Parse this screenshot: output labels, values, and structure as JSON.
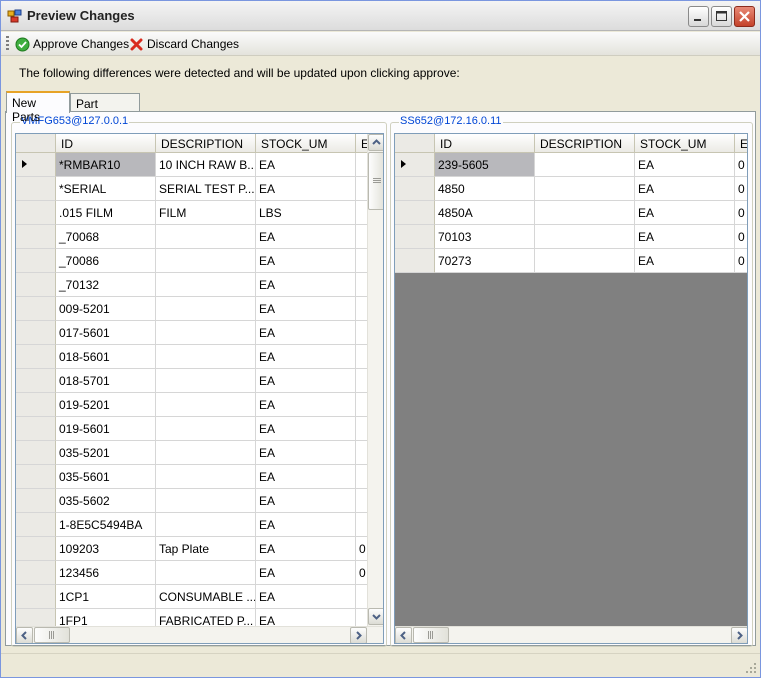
{
  "window": {
    "title": "Preview Changes"
  },
  "toolbar": {
    "approve_label": "Approve Changes",
    "approve_icon": "check-circle-icon",
    "discard_label": "Discard Changes",
    "discard_icon": "red-x-icon"
  },
  "message": "The following differences were detected and will be updated upon clicking approve:",
  "tabs": [
    {
      "label": "New Parts",
      "selected": true
    },
    {
      "label": "Part Updates",
      "selected": false
    }
  ],
  "left_panel": {
    "title": "VMFG653@127.0.0.1",
    "columns": [
      "ID",
      "DESCRIPTION",
      "STOCK_UM",
      "E"
    ],
    "rows": [
      [
        "*RMBAR10",
        "10 INCH RAW B...",
        "EA",
        ""
      ],
      [
        "*SERIAL",
        "SERIAL TEST P...",
        "EA",
        ""
      ],
      [
        ".015 FILM",
        "FILM",
        "LBS",
        ""
      ],
      [
        "_70068",
        "",
        "EA",
        ""
      ],
      [
        "_70086",
        "",
        "EA",
        ""
      ],
      [
        "_70132",
        "",
        "EA",
        ""
      ],
      [
        "009-5201",
        "",
        "EA",
        ""
      ],
      [
        "017-5601",
        "",
        "EA",
        ""
      ],
      [
        "018-5601",
        "",
        "EA",
        ""
      ],
      [
        "018-5701",
        "",
        "EA",
        ""
      ],
      [
        "019-5201",
        "",
        "EA",
        ""
      ],
      [
        "019-5601",
        "",
        "EA",
        ""
      ],
      [
        "035-5201",
        "",
        "EA",
        ""
      ],
      [
        "035-5601",
        "",
        "EA",
        ""
      ],
      [
        "035-5602",
        "",
        "EA",
        ""
      ],
      [
        "1-8E5C5494BA",
        "",
        "EA",
        ""
      ],
      [
        "109203",
        "Tap Plate",
        "EA",
        "0"
      ],
      [
        "123456",
        "",
        "EA",
        "0"
      ],
      [
        "1CP1",
        "CONSUMABLE ...",
        "EA",
        ""
      ],
      [
        "1FP1",
        "FABRICATED P...",
        "EA",
        ""
      ]
    ]
  },
  "right_panel": {
    "title": "SS652@172.16.0.11",
    "columns": [
      "ID",
      "DESCRIPTION",
      "STOCK_UM",
      "E"
    ],
    "rows": [
      [
        "239-5605",
        "",
        "EA",
        "0"
      ],
      [
        "4850",
        "",
        "EA",
        "0"
      ],
      [
        "4850A",
        "",
        "EA",
        "0"
      ],
      [
        "70103",
        "",
        "EA",
        "0"
      ],
      [
        "70273",
        "",
        "EA",
        "0"
      ]
    ]
  }
}
